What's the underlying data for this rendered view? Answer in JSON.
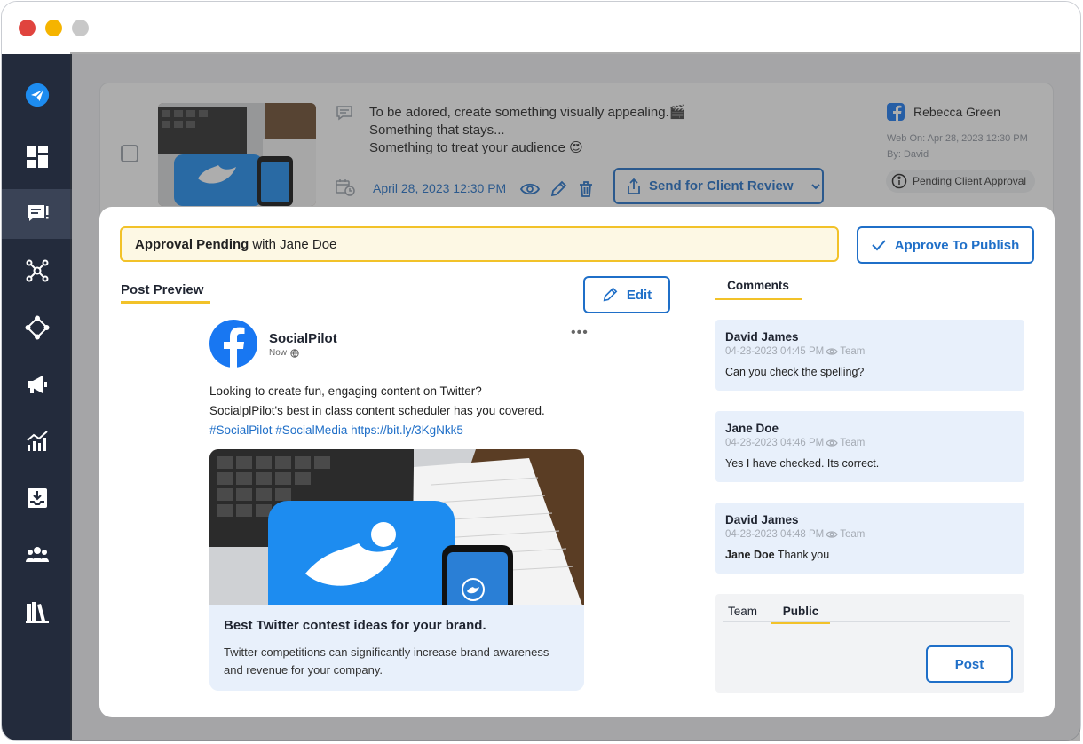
{
  "window": {
    "controls": [
      "close",
      "minimize",
      "zoom"
    ]
  },
  "sidebar": {
    "items": [
      {
        "icon": "paper-plane-icon",
        "active": false
      },
      {
        "icon": "dashboard-icon",
        "active": false
      },
      {
        "icon": "approval-message-icon",
        "active": true
      },
      {
        "icon": "network-icon",
        "active": false
      },
      {
        "icon": "connections-icon",
        "active": false
      },
      {
        "icon": "megaphone-icon",
        "active": false
      },
      {
        "icon": "analytics-icon",
        "active": false
      },
      {
        "icon": "inbox-download-icon",
        "active": false
      },
      {
        "icon": "team-icon",
        "active": false
      },
      {
        "icon": "library-icon",
        "active": false
      }
    ]
  },
  "background_post": {
    "text_lines": [
      "To be adored, create something visually appealing.🎬",
      "Something that stays...",
      "Something to treat your audience 😍"
    ],
    "date": "April 28, 2023 12:30 PM",
    "send_button": "Send for Client Review",
    "account_name": "Rebecca Green",
    "web_on": "Web On: Apr 28, 2023 12:30 PM",
    "by": "By: David",
    "status": "Pending Client Approval"
  },
  "modal": {
    "banner_bold": "Approval Pending",
    "banner_rest": "with Jane Doe",
    "approve_button": "Approve To Publish",
    "preview_tab": "Post Preview",
    "edit_button": "Edit",
    "post": {
      "page_name": "SocialPilot",
      "time": "Now",
      "line1": "Looking to create fun, engaging content on Twitter?",
      "line2": "SocialplPilot's best in class content scheduler has you covered.",
      "tags": "#SocialPilot #SocialMedia https://bit.ly/3KgNkk5",
      "link_title": "Best Twitter contest ideas for your brand.",
      "link_desc": "Twitter competitions can significantly increase brand awareness and revenue for your company."
    },
    "comments_tab": "Comments",
    "comments": [
      {
        "author": "David James",
        "date": "04-28-2023 04:45 PM",
        "visibility": "Team",
        "mention": "",
        "text": "Can you check the spelling?"
      },
      {
        "author": "Jane Doe",
        "date": "04-28-2023 04:46 PM",
        "visibility": "Team",
        "mention": "",
        "text": "Yes I have checked. Its correct."
      },
      {
        "author": "David James",
        "date": "04-28-2023 04:48 PM",
        "visibility": "Team",
        "mention": "Jane Doe",
        "text": "Thank you"
      }
    ],
    "reply": {
      "tab_team": "Team",
      "tab_public": "Public",
      "post_button": "Post"
    }
  },
  "colors": {
    "accent": "#1f6fc8",
    "highlight": "#f2c229",
    "sidebar": "#232b3c",
    "comment_bg": "#e8f0fb"
  }
}
